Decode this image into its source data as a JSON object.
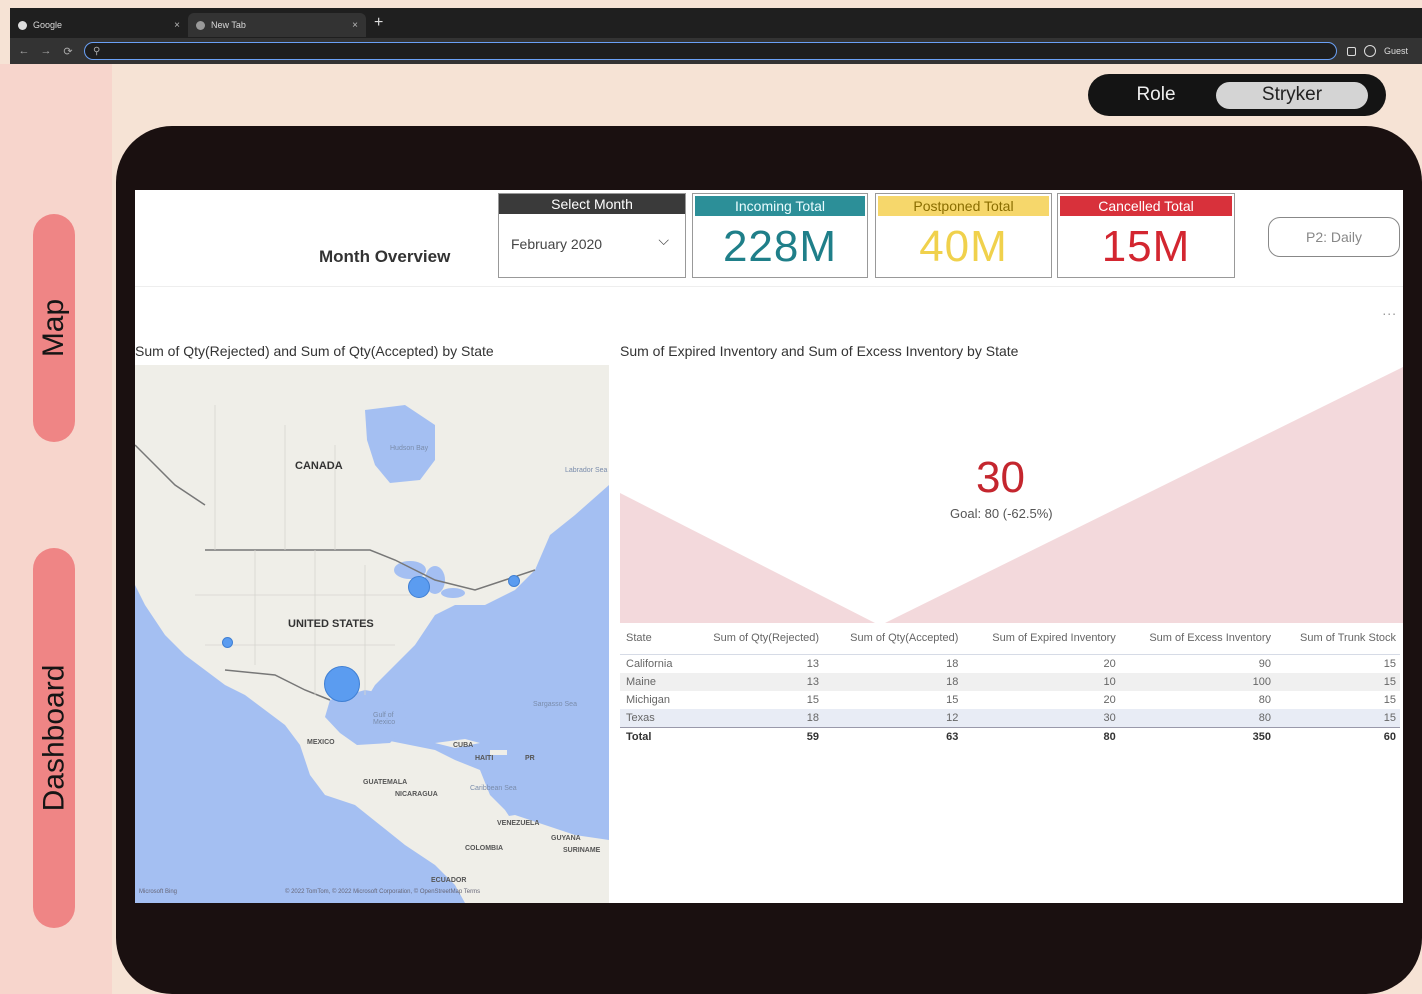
{
  "browser": {
    "tabs": [
      {
        "title": "Google",
        "close": "×"
      },
      {
        "title": "New Tab",
        "close": "×"
      }
    ],
    "new_tab": "+",
    "omnibox_icon": "search-icon",
    "profile": "Guest"
  },
  "side_nav": {
    "map_label": "Map",
    "dashboard_label": "Dashboard"
  },
  "role_toggle": {
    "label": "Role",
    "value": "Stryker"
  },
  "header": {
    "title": "Month Overview",
    "month_select": {
      "header": "Select Month",
      "value": "February 2020"
    },
    "kpis": {
      "incoming": {
        "label": "Incoming Total",
        "value": "228M",
        "color": "#2c8f98"
      },
      "postponed": {
        "label": "Postponed Total",
        "value": "40M",
        "color": "#f6d76b"
      },
      "cancelled": {
        "label": "Cancelled Total",
        "value": "15M",
        "color": "#d8313b"
      }
    },
    "p2_button": "P2: Daily",
    "more": "..."
  },
  "map_visual": {
    "title": "Sum of Qty(Rejected) and Sum of Qty(Accepted) by State",
    "labels": {
      "canada": "CANADA",
      "us": "UNITED STATES",
      "mexico": "MEXICO",
      "hudson": "Hudson Bay",
      "gulf": "Gulf of Mexico",
      "labrador": "Labrador Sea",
      "sargasso": "Sargasso Sea",
      "caribbean": "Caribbean Sea",
      "cuba": "CUBA",
      "haiti": "HAITI",
      "pr": "PR",
      "guatemala": "GUATEMALA",
      "nicaragua": "NICARAGUA",
      "venezuela": "VENEZUELA",
      "colombia": "COLOMBIA",
      "guyana": "GUYANA",
      "suriname": "SURINAME",
      "ecuador": "ECUADOR"
    },
    "attribution": "Microsoft Bing",
    "copyright": "© 2022 TomTom, © 2022 Microsoft Corporation, © OpenStreetMap  Terms"
  },
  "gauge_visual": {
    "title": "Sum of Expired Inventory and Sum of Excess Inventory by State",
    "value": "30",
    "goal": "Goal: 80 (-62.5%)"
  },
  "table": {
    "columns": [
      "State",
      "Sum of Qty(Rejected)",
      "Sum of Qty(Accepted)",
      "Sum of Expired Inventory",
      "Sum of Excess Inventory",
      "Sum of Trunk Stock"
    ],
    "rows": [
      [
        "California",
        "13",
        "18",
        "20",
        "90",
        "15"
      ],
      [
        "Maine",
        "13",
        "18",
        "10",
        "100",
        "15"
      ],
      [
        "Michigan",
        "15",
        "15",
        "20",
        "80",
        "15"
      ],
      [
        "Texas",
        "18",
        "12",
        "30",
        "80",
        "15"
      ]
    ],
    "total": [
      "Total",
      "59",
      "63",
      "80",
      "350",
      "60"
    ]
  }
}
